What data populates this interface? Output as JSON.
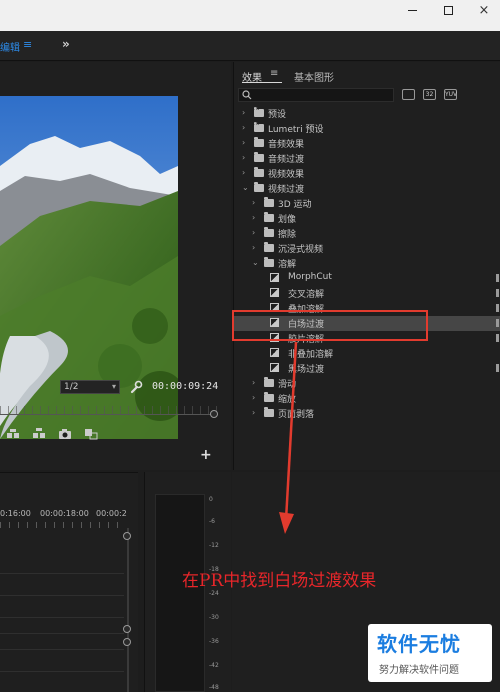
{
  "titlebar": {
    "min": "",
    "max": "",
    "close": "×"
  },
  "workspace": {
    "label": "编辑",
    "menu": "≡",
    "more": "»"
  },
  "monitor": {
    "zoom": "1/2",
    "timecode": "00:00:09:24",
    "add": "+"
  },
  "effects_panel": {
    "tab_active": "效果",
    "tab_menu": "≡",
    "tab_2": "基本图形",
    "search_placeholder": "",
    "buttons": [
      "",
      "32",
      "YUV"
    ],
    "tree": [
      {
        "label": "预设",
        "expanded": false,
        "level": 0,
        "kind": "folder-star"
      },
      {
        "label": "Lumetri 预设",
        "expanded": false,
        "level": 0,
        "kind": "folder-star"
      },
      {
        "label": "音频效果",
        "expanded": false,
        "level": 0,
        "kind": "folder"
      },
      {
        "label": "音频过渡",
        "expanded": false,
        "level": 0,
        "kind": "folder"
      },
      {
        "label": "视频效果",
        "expanded": false,
        "level": 0,
        "kind": "folder"
      },
      {
        "label": "视频过渡",
        "expanded": true,
        "level": 0,
        "kind": "folder"
      },
      {
        "label": "3D 运动",
        "expanded": false,
        "level": 1,
        "kind": "folder"
      },
      {
        "label": "划像",
        "expanded": false,
        "level": 1,
        "kind": "folder"
      },
      {
        "label": "擦除",
        "expanded": false,
        "level": 1,
        "kind": "folder"
      },
      {
        "label": "沉浸式视频",
        "expanded": false,
        "level": 1,
        "kind": "folder"
      },
      {
        "label": "溶解",
        "expanded": true,
        "level": 1,
        "kind": "folder"
      },
      {
        "label": "MorphCut",
        "level": 2,
        "kind": "effect",
        "mark": true
      },
      {
        "label": "交叉溶解",
        "level": 2,
        "kind": "effect",
        "mark": true
      },
      {
        "label": "叠加溶解",
        "level": 2,
        "kind": "effect",
        "mark": true
      },
      {
        "label": "白场过渡",
        "level": 2,
        "kind": "effect",
        "mark": true,
        "highlight": true
      },
      {
        "label": "胶片溶解",
        "level": 2,
        "kind": "effect",
        "mark": true
      },
      {
        "label": "非叠加溶解",
        "level": 2,
        "kind": "effect",
        "mark": false
      },
      {
        "label": "黑场过渡",
        "level": 2,
        "kind": "effect",
        "mark": true
      },
      {
        "label": "滑动",
        "expanded": false,
        "level": 1,
        "kind": "folder"
      },
      {
        "label": "缩放",
        "expanded": false,
        "level": 1,
        "kind": "folder"
      },
      {
        "label": "页面剥落",
        "expanded": false,
        "level": 1,
        "kind": "folder"
      }
    ]
  },
  "timeline": {
    "ruler": [
      "0:16:00",
      "00:00:18:00",
      "00:00:2"
    ]
  },
  "meter": {
    "ticks": [
      "0",
      "-6",
      "-12",
      "-18",
      "-24",
      "-30",
      "-36",
      "-42",
      "-48"
    ]
  },
  "annotation": {
    "caption": "在PR中找到白场过渡效果",
    "color": "#e8262a"
  },
  "watermark": {
    "title": "软件无忧",
    "subtitle": "努力解决软件问题"
  }
}
